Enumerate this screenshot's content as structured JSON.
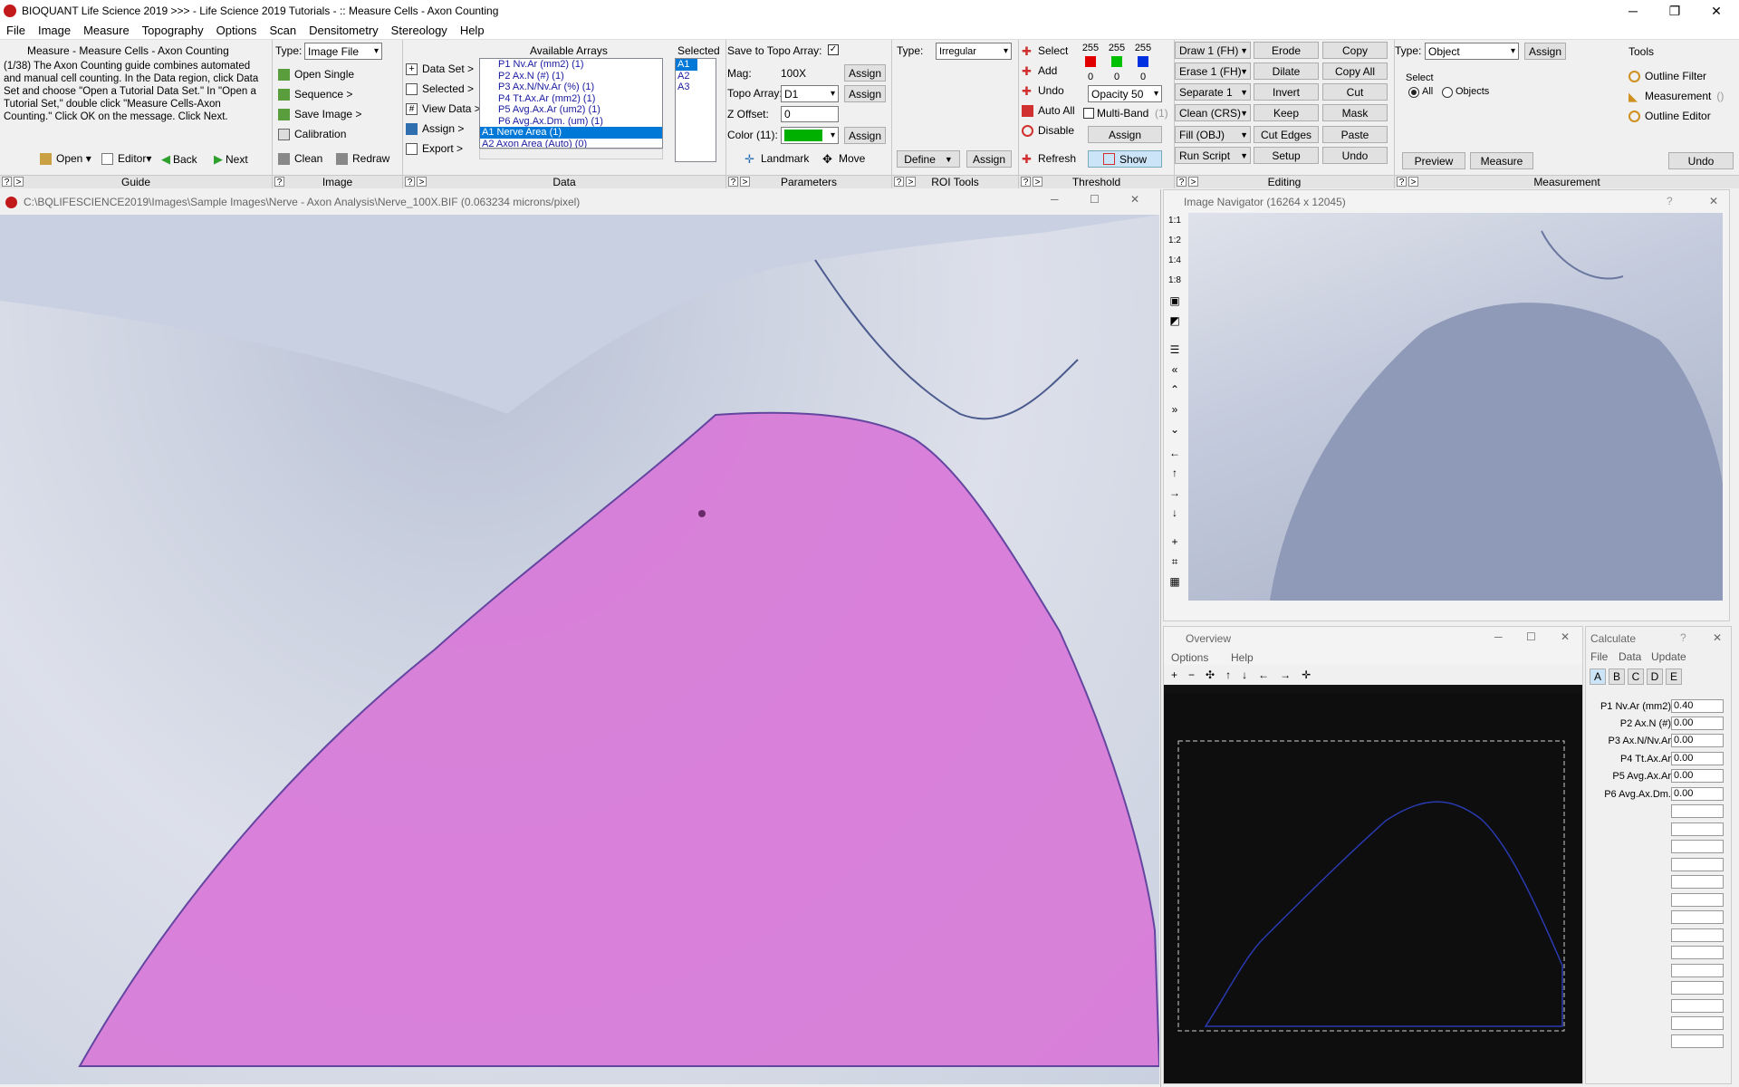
{
  "window": {
    "title": "BIOQUANT Life Science 2019 >>>  - Life Science 2019 Tutorials - :: Measure Cells - Axon Counting"
  },
  "menu": [
    "File",
    "Image",
    "Measure",
    "Topography",
    "Options",
    "Scan",
    "Densitometry",
    "Stereology",
    "Help"
  ],
  "guide": {
    "heading": "Measure - Measure Cells - Axon Counting",
    "text": "(1/38) The Axon Counting guide combines automated and manual cell counting. In the Data region, click Data Set and choose \"Open a Tutorial Data Set.\" In \"Open a Tutorial Set,\" double click \"Measure Cells-Axon Counting.\" Click OK on the message. Click Next.",
    "open": "Open",
    "editor": "Editor",
    "back": "Back",
    "next": "Next",
    "section": "Guide"
  },
  "image_panel": {
    "type_label": "Type:",
    "type_value": "Image File",
    "open_single": "Open Single",
    "sequence": "Sequence >",
    "save_image": "Save Image >",
    "calibration": "Calibration",
    "clean": "Clean",
    "redraw": "Redraw",
    "section": "Image"
  },
  "data_panel": {
    "data_set": "Data Set >",
    "selected": "Selected >",
    "view_data": "View Data >",
    "assign": "Assign >",
    "export": "Export >",
    "available_label": "Available Arrays",
    "selected_label": "Selected",
    "available": [
      "P1 Nv.Ar (mm2) (1)",
      "P2 Ax.N (#) (1)",
      "P3 Ax.N/Nv.Ar (%) (1)",
      "P4 Tt.Ax.Ar (mm2) (1)",
      "P5 Avg.Ax.Ar (um2) (1)",
      "P6 Avg.Ax.Dm. (um) (1)",
      "A1 Nerve Area (1)",
      "A2 Axon Area (Auto) (0)"
    ],
    "selected_items": [
      "A1",
      "A2",
      "A3"
    ],
    "section": "Data"
  },
  "params_panel": {
    "save_topo": "Save to Topo Array:",
    "mag_label": "Mag:",
    "mag_value": "100X",
    "topo_label": "Topo Array:",
    "topo_value": "D1",
    "zoffset_label": "Z Offset:",
    "zoffset_value": "0",
    "color_label": "Color (11):",
    "assign": "Assign",
    "landmark": "Landmark",
    "move": "Move",
    "section": "Parameters",
    "color_green": "#00b000"
  },
  "roi_panel": {
    "type_label": "Type:",
    "type_value": "Irregular",
    "define": "Define",
    "assign": "Assign",
    "section": "ROI Tools"
  },
  "threshold_panel": {
    "select": "Select",
    "add": "Add",
    "undo": "Undo",
    "auto_all": "Auto All",
    "disable": "Disable",
    "refresh": "Refresh",
    "show": "Show",
    "assign": "Assign",
    "multiband": "Multi-Band",
    "multiband_count": "(1)",
    "opacity": "Opacity 50",
    "top_values": [
      "255",
      "255",
      "255"
    ],
    "bottom_values": [
      "0",
      "0",
      "0"
    ],
    "section": "Threshold"
  },
  "editing_panel": {
    "col1": [
      "Draw 1 (FH)",
      "Erase 1 (FH)",
      "Separate 1",
      "Clean (CRS)",
      "Fill (OBJ)",
      "Run Script"
    ],
    "col2": [
      "Erode",
      "Dilate",
      "Invert",
      "Keep",
      "Cut Edges",
      "Setup"
    ],
    "col3": [
      "Copy",
      "Copy All",
      "Cut",
      "Mask",
      "Paste",
      "Undo"
    ],
    "section": "Editing"
  },
  "measurement_panel": {
    "type_label": "Type:",
    "type_value": "Object",
    "assign": "Assign",
    "select_label": "Select",
    "all": "All",
    "objects": "Objects",
    "tools_label": "Tools",
    "outline_filter": "Outline Filter",
    "measurement": "Measurement",
    "measurement_suffix": "()",
    "outline_editor": "Outline Editor",
    "preview": "Preview",
    "measure": "Measure",
    "undo": "Undo",
    "section": "Measurement"
  },
  "image_window": {
    "title": "C:\\BQLIFESCIENCE2019\\Images\\Sample Images\\Nerve - Axon Analysis\\Nerve_100X.BIF (0.063234 microns/pixel)"
  },
  "navigator": {
    "title": "Image Navigator (16264 x 12045)",
    "scales": [
      "1:1",
      "1:2",
      "1:4",
      "1:8"
    ]
  },
  "overview": {
    "title": "Overview",
    "menu": [
      "Options",
      "Help"
    ]
  },
  "calculate": {
    "title": "Calculate",
    "menu": [
      "File",
      "Data",
      "Update"
    ],
    "tabs": [
      "A",
      "B",
      "C",
      "D",
      "E"
    ],
    "rows": [
      {
        "label": "P1 Nv.Ar (mm2)",
        "value": "0.40"
      },
      {
        "label": "P2 Ax.N (#)",
        "value": "0.00"
      },
      {
        "label": "P3 Ax.N/Nv.Ar",
        "value": "0.00"
      },
      {
        "label": "P4 Tt.Ax.Ar",
        "value": "0.00"
      },
      {
        "label": "P5 Avg.Ax.Ar",
        "value": "0.00"
      },
      {
        "label": "P6 Avg.Ax.Dm.",
        "value": "0.00"
      }
    ]
  }
}
